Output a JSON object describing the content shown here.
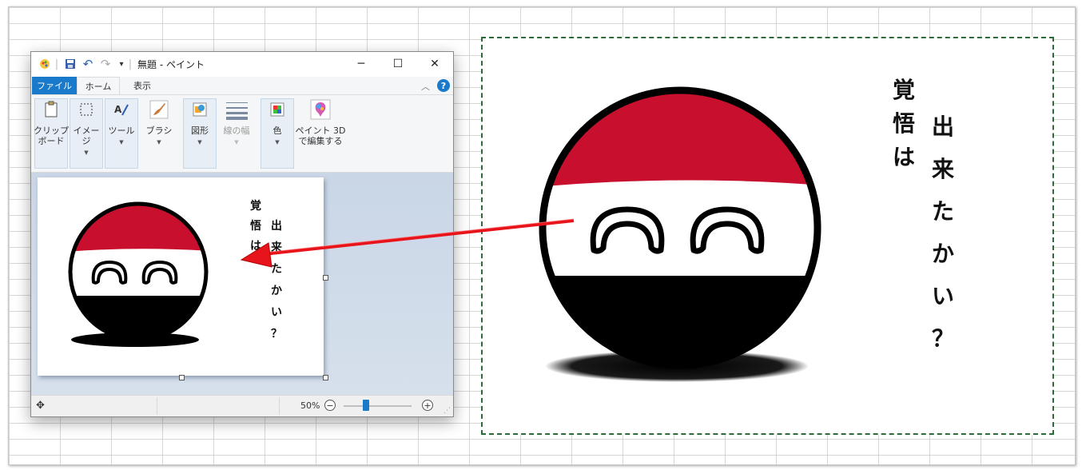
{
  "paint": {
    "title": "無題 - ペイント",
    "quick_access": {
      "undo": "↶",
      "redo": "↷",
      "customize": "▾",
      "separator": "|"
    },
    "window_buttons": {
      "minimize": "─",
      "maximize": "☐",
      "close": "✕"
    },
    "tabs": {
      "file": "ファイル",
      "home": "ホーム",
      "view": "表示"
    },
    "ribbon_collapse": "︿",
    "help": "?",
    "ribbon": {
      "clipboard": "クリップ\nボード",
      "image": "イメージ",
      "tools": "ツール",
      "brushes": "ブラシ",
      "shapes": "図形",
      "size": "線の幅",
      "colors": "色",
      "paint3d": "ペイント 3D\nで編集する"
    },
    "status": {
      "zoom": "50%",
      "zoom_level": 0.5,
      "zoom_out": "−",
      "zoom_in": "+"
    }
  },
  "artwork": {
    "line1": [
      "覚",
      "悟",
      "は"
    ],
    "line2": [
      "出",
      "来",
      "た",
      "か",
      "い",
      "？"
    ]
  },
  "colors": {
    "flag_red": "#c8102e",
    "flag_white": "#ffffff",
    "flag_black": "#000000",
    "arrow": "#e8141b",
    "selection_border": "#2f6b3a",
    "accent": "#1979ca"
  }
}
